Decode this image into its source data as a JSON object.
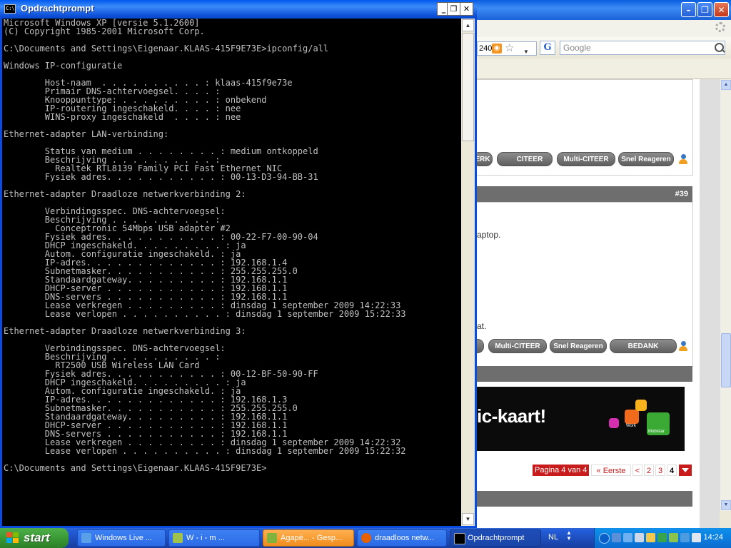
{
  "browser": {
    "address_partial": "240,",
    "search_engine_icon": "G",
    "search_placeholder": "Google",
    "buttons_row1": [
      "ERK",
      "CITEER",
      "Multi-CITEER",
      "Snel Reageren"
    ],
    "post_number": "#39",
    "post_text_1": "aptop.",
    "post_text_2": "at.",
    "buttons_row2": [
      "Multi-CITEER",
      "Snel Reageren",
      "BEDANK"
    ],
    "ad_text": "ic-kaart!",
    "ad_small_1": "Work",
    "ad_small_2": "Mobistar",
    "pager": {
      "label": "Pagina 4 van 4",
      "first": "« Eerste",
      "prev": "<",
      "pages": [
        "2",
        "3",
        "4"
      ]
    }
  },
  "cmd": {
    "title": "Opdrachtprompt",
    "icon_text": "C:\\",
    "output": [
      "Microsoft Windows XP [versie 5.1.2600]",
      "(C) Copyright 1985-2001 Microsoft Corp.",
      "",
      "C:\\Documents and Settings\\Eigenaar.KLAAS-415F9E73E>ipconfig/all",
      "",
      "Windows IP-configuratie",
      "",
      "        Host-naam  . . . . . . . . . . : klaas-415f9e73e",
      "        Primair DNS-achtervoegsel. . . . :",
      "        Knooppunttype: . . . . . . . . . : onbekend",
      "        IP-routering ingeschakeld. . . . : nee",
      "        WINS-proxy ingeschakeld  . . . . : nee",
      "",
      "Ethernet-adapter LAN-verbinding:",
      "",
      "        Status van medium . . . . . . . . : medium ontkoppeld",
      "        Beschrijving . . . . . . . . . . :",
      "          Realtek RTL8139 Family PCI Fast Ethernet NIC",
      "        Fysiek adres. . . . . . . . . . . : 00-13-D3-94-BB-31",
      "",
      "Ethernet-adapter Draadloze netwerkverbinding 2:",
      "",
      "        Verbindingsspec. DNS-achtervoegsel:",
      "        Beschrijving . . . . . . . . . . :",
      "          Conceptronic 54Mbps USB adapter #2",
      "        Fysiek adres. . . . . . . . . . . : 00-22-F7-00-90-04",
      "        DHCP ingeschakeld. . . . . . . . . : ja",
      "        Autom. configuratie ingeschakeld. : ja",
      "        IP-adres. . . . . . . . . . . . . : 192.168.1.4",
      "        Subnetmasker. . . . . . . . . . . : 255.255.255.0",
      "        Standaardgateway. . . . . . . . . : 192.168.1.1",
      "        DHCP-server . . . . . . . . . . . : 192.168.1.1",
      "        DNS-servers . . . . . . . . . . . : 192.168.1.1",
      "        Lease verkregen . . . . . . . . . : dinsdag 1 september 2009 14:22:33",
      "        Lease verlopen . . . . . . . . . . : dinsdag 1 september 2009 15:22:33",
      "",
      "Ethernet-adapter Draadloze netwerkverbinding 3:",
      "",
      "        Verbindingsspec. DNS-achtervoegsel:",
      "        Beschrijving . . . . . . . . . . :",
      "          RT2500 USB Wireless LAN Card",
      "        Fysiek adres. . . . . . . . . . . : 00-12-BF-50-90-FF",
      "        DHCP ingeschakeld. . . . . . . . . : ja",
      "        Autom. configuratie ingeschakeld. : ja",
      "        IP-adres. . . . . . . . . . . . . : 192.168.1.3",
      "        Subnetmasker. . . . . . . . . . . : 255.255.255.0",
      "        Standaardgateway. . . . . . . . . : 192.168.1.1",
      "        DHCP-server . . . . . . . . . . . : 192.168.1.1",
      "        DNS-servers . . . . . . . . . . . : 192.168.1.1",
      "        Lease verkregen . . . . . . . . . : dinsdag 1 september 2009 14:22:32",
      "        Lease verlopen . . . . . . . . . . : dinsdag 1 september 2009 15:22:32",
      "",
      "C:\\Documents and Settings\\Eigenaar.KLAAS-415F9E73E>"
    ]
  },
  "taskbar": {
    "start_label": "start",
    "tasks": [
      {
        "label": "Windows Live ...",
        "icon": "windows-live-icon"
      },
      {
        "label": "W - i - m  ...",
        "icon": "wimp-icon"
      },
      {
        "label": "Agapé... - Gesp...",
        "icon": "agape-icon"
      },
      {
        "label": "draadloos netw...",
        "icon": "firefox-icon"
      },
      {
        "label": "Opdrachtprompt",
        "icon": "cmd-icon"
      }
    ],
    "language": "NL",
    "clock": "14:24"
  },
  "colors": {
    "xp_blue": "#0a4be0",
    "start_green": "#3c9c36",
    "page_red": "#c81c1c",
    "console_text": "#c0c0c0"
  }
}
